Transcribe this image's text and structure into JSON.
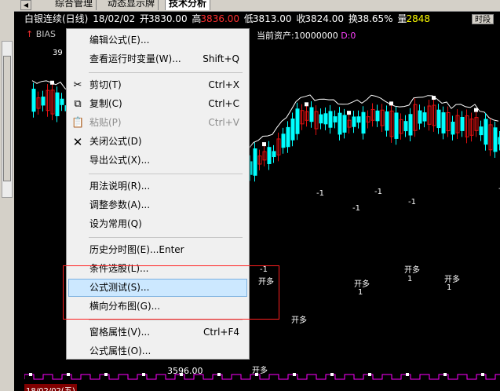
{
  "tabs": [
    {
      "label": "综合管理",
      "active": false
    },
    {
      "label": "动态显示牌",
      "active": false
    },
    {
      "label": "技术分析",
      "active": true
    }
  ],
  "infobar": {
    "name": "白银连续(日线)",
    "date": "18/02/02",
    "open_label": "开",
    "open": "3830.00",
    "high_label": "高",
    "high": "3836.00",
    "low_label": "低",
    "low": "3813.00",
    "close_label": "收",
    "close": "3824.00",
    "turnover_label": "换",
    "turnover": "38.65%",
    "volume_label": "量",
    "volume": "2848",
    "timeframe_button": "时段"
  },
  "indicator": {
    "name": "BIAS",
    "arrow": "↑"
  },
  "asset": {
    "label": "当前资产:10000000",
    "d": "D:0"
  },
  "price_labels": {
    "top": "39",
    "bottom": "3596.00"
  },
  "annotations": {
    "open_long": "开多",
    "minus_one": "-1",
    "one": "1"
  },
  "bottom_date": "18/02/02(五)",
  "colors": {
    "up_candle": "#e01010",
    "down_candle": "#00ffff",
    "line": "#ffffff",
    "signal": "#ffff00",
    "menu_highlight": "#cce8ff",
    "callout_box": "#ff2020",
    "osc": "#ff00ff"
  },
  "menu": {
    "items": [
      {
        "type": "item",
        "name": "edit-formula",
        "label": "编辑公式(E)...",
        "shortcut": "",
        "icon": "",
        "disabled": false,
        "highlighted": false
      },
      {
        "type": "item",
        "name": "view-runtime-vars",
        "label": "查看运行时变量(W)...",
        "shortcut": "Shift+Q",
        "icon": "",
        "disabled": false,
        "highlighted": false
      },
      {
        "type": "separator"
      },
      {
        "type": "item",
        "name": "cut",
        "label": "剪切(T)",
        "shortcut": "Ctrl+X",
        "icon": "scissors-icon",
        "disabled": false,
        "highlighted": false
      },
      {
        "type": "item",
        "name": "copy",
        "label": "复制(C)",
        "shortcut": "Ctrl+C",
        "icon": "copy-icon",
        "disabled": false,
        "highlighted": false
      },
      {
        "type": "item",
        "name": "paste",
        "label": "粘贴(P)",
        "shortcut": "Ctrl+V",
        "icon": "paste-icon",
        "disabled": true,
        "highlighted": false
      },
      {
        "type": "item",
        "name": "close-formula",
        "label": "关闭公式(D)",
        "shortcut": "",
        "icon": "close-x-icon",
        "disabled": false,
        "highlighted": false
      },
      {
        "type": "item",
        "name": "export-formula",
        "label": "导出公式(X)...",
        "shortcut": "",
        "icon": "",
        "disabled": false,
        "highlighted": false
      },
      {
        "type": "separator"
      },
      {
        "type": "item",
        "name": "usage-help",
        "label": "用法说明(R)...",
        "shortcut": "",
        "icon": "",
        "disabled": false,
        "highlighted": false
      },
      {
        "type": "item",
        "name": "adjust-params",
        "label": "调整参数(A)...",
        "shortcut": "",
        "icon": "",
        "disabled": false,
        "highlighted": false
      },
      {
        "type": "item",
        "name": "set-common",
        "label": "设为常用(Q)",
        "shortcut": "",
        "icon": "",
        "disabled": false,
        "highlighted": false
      },
      {
        "type": "separator"
      },
      {
        "type": "item",
        "name": "history-timechart",
        "label": "历史分时图(E)...Enter",
        "shortcut": "",
        "icon": "",
        "disabled": false,
        "highlighted": false
      },
      {
        "type": "item",
        "name": "condition-select",
        "label": "条件选股(L)...",
        "shortcut": "",
        "icon": "",
        "disabled": false,
        "highlighted": false
      },
      {
        "type": "item",
        "name": "formula-test",
        "label": "公式测试(S)...",
        "shortcut": "",
        "icon": "",
        "disabled": false,
        "highlighted": true
      },
      {
        "type": "item",
        "name": "horizontal-distribution",
        "label": "横向分布图(G)...",
        "shortcut": "",
        "icon": "",
        "disabled": false,
        "highlighted": false
      },
      {
        "type": "separator"
      },
      {
        "type": "item",
        "name": "pane-properties",
        "label": "窗格属性(V)...",
        "shortcut": "Ctrl+F4",
        "icon": "",
        "disabled": false,
        "highlighted": false
      },
      {
        "type": "item",
        "name": "formula-properties",
        "label": "公式属性(O)...",
        "shortcut": "",
        "icon": "",
        "disabled": false,
        "highlighted": false
      }
    ]
  }
}
